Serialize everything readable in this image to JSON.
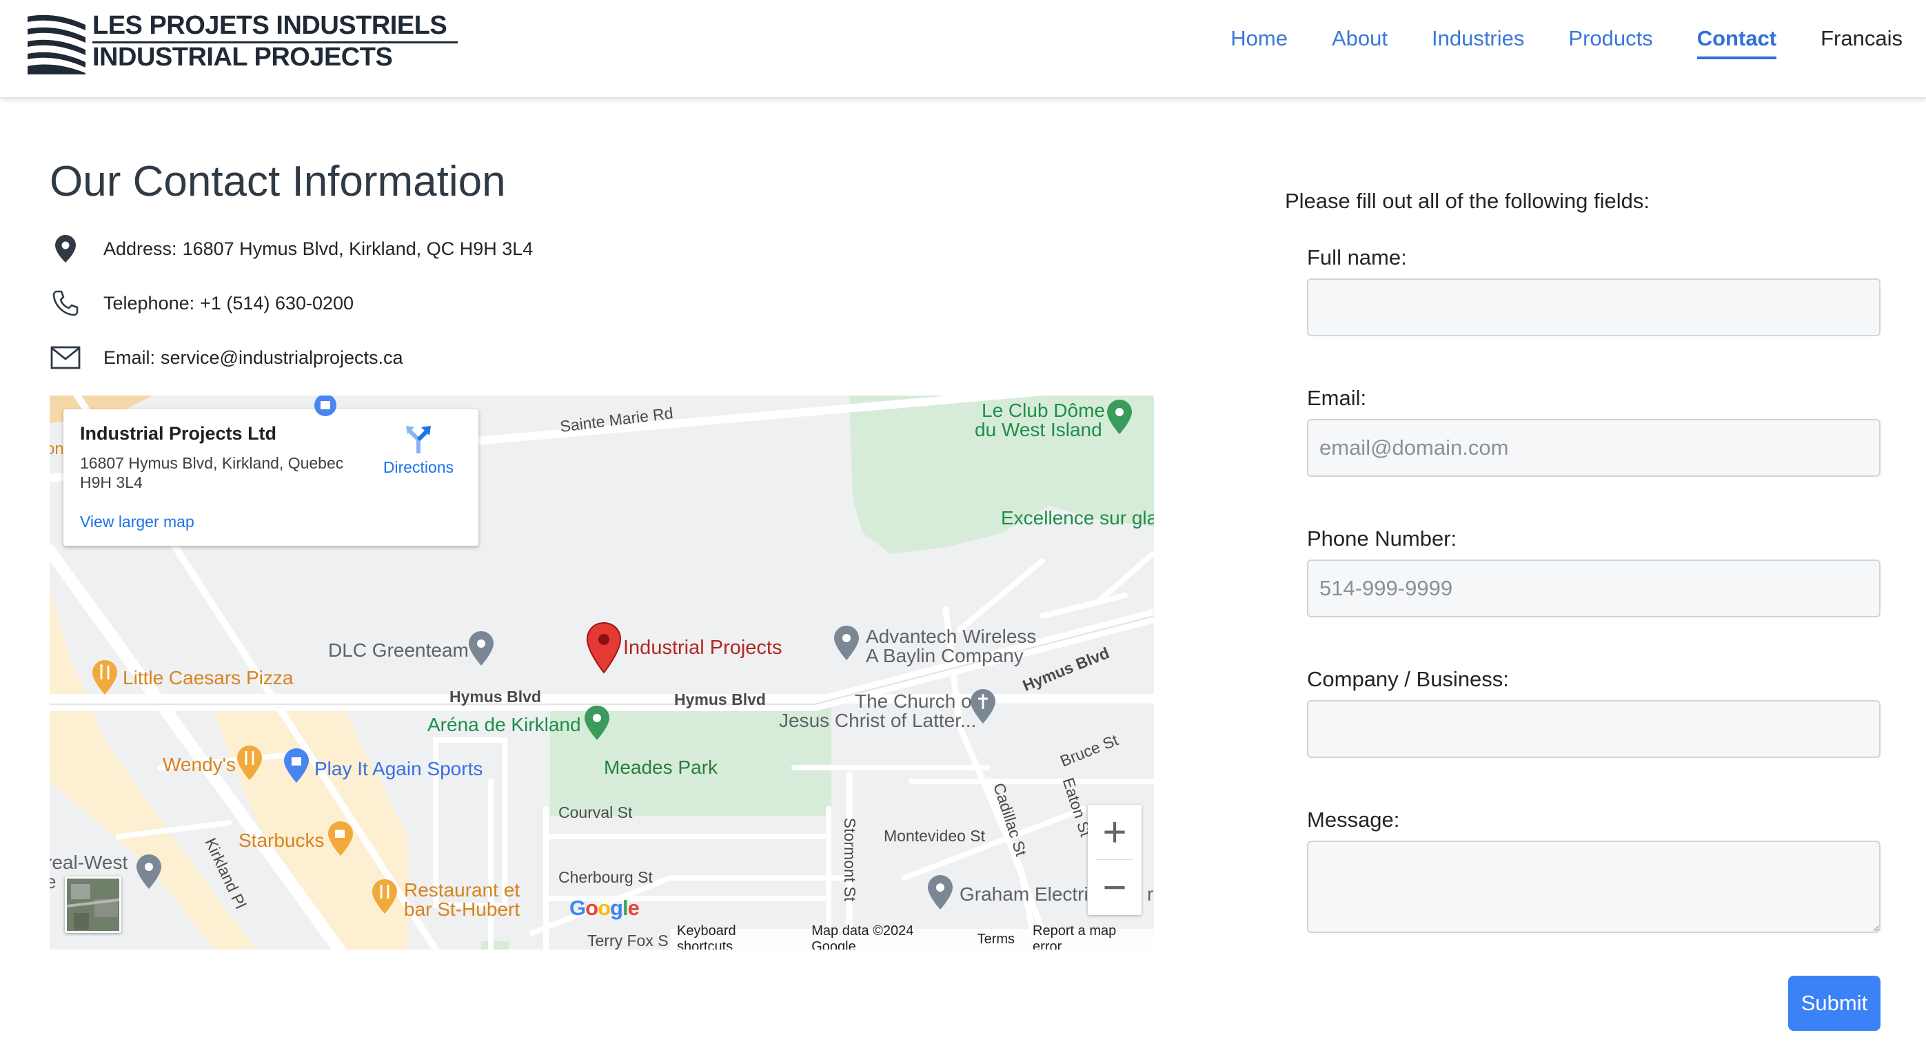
{
  "brand": {
    "line1": "LES PROJETS INDUSTRIELS",
    "line2": "INDUSTRIAL PROJECTS"
  },
  "nav": {
    "items": [
      {
        "label": "Home",
        "active": false
      },
      {
        "label": "About",
        "active": false
      },
      {
        "label": "Industries",
        "active": false
      },
      {
        "label": "Products",
        "active": false
      },
      {
        "label": "Contact",
        "active": true
      }
    ],
    "language": "Francais"
  },
  "contact": {
    "title": "Our Contact Information",
    "address": {
      "label": "Address:",
      "value": "16807 Hymus Blvd, Kirkland, QC H9H 3L4",
      "icon": "map-pin-icon"
    },
    "telephone": {
      "label": "Telephone:",
      "value": "+1 (514) 630-0200",
      "icon": "phone-icon"
    },
    "email": {
      "label": "Email:",
      "value": "service@industrialprojects.ca",
      "icon": "envelope-icon"
    }
  },
  "map": {
    "card": {
      "name": "Industrial Projects Ltd",
      "address": "16807 Hymus Blvd, Kirkland, Quebec H9H 3L4",
      "directions": "Directions",
      "larger_map": "View larger map"
    },
    "labels": {
      "sainte_marie": "Sainte Marie Rd",
      "club_dome_1": "Le Club Dôme",
      "club_dome_2": "du West Island",
      "excellence": "Excellence sur gla",
      "dlc": "DLC Greenteam",
      "industrial_projects": "Industrial Projects",
      "advantech_1": "Advantech Wireless",
      "advantech_2": "A Baylin Company",
      "little_caesars": "Little Caesars Pizza",
      "hymus_1": "Hymus Blvd",
      "hymus_2": "Hymus Blvd",
      "hymus_3": "Hymus Blvd",
      "church_1": "The Church of",
      "church_2": "Jesus Christ of Latter...",
      "arena": "Aréna de Kirkland",
      "bruce": "Bruce St",
      "wendys": "Wendy's",
      "play_it_again": "Play It Again Sports",
      "meades": "Meades Park",
      "eaton": "Eaton St",
      "cadillac": "Cadillac St",
      "courval": "Courval St",
      "starbucks": "Starbucks",
      "montevideo": "Montevideo St",
      "stormont": "Stormont St",
      "real_west_1": "real-West",
      "real_west_2": "e",
      "kirkland_pl": "Kirkland Pl",
      "restaurant_1": "Restaurant et",
      "restaurant_2": "bar St-Hubert",
      "cherbourg": "Cherbourg St",
      "graham": "Graham Electri",
      "graham_tail": "r",
      "terry_fox": "Terry Fox S",
      "top_partial": "on"
    },
    "google_logo": "Google",
    "zoom_in": "+",
    "zoom_out": "−",
    "attribution": {
      "shortcuts": "Keyboard shortcuts",
      "data": "Map data ©2024 Google",
      "terms": "Terms",
      "report": "Report a map error"
    }
  },
  "form": {
    "intro": "Please fill out all of the following fields:",
    "full_name": {
      "label": "Full name:",
      "placeholder": "",
      "value": ""
    },
    "email": {
      "label": "Email:",
      "placeholder": "email@domain.com",
      "value": ""
    },
    "phone": {
      "label": "Phone Number:",
      "placeholder": "514-999-9999",
      "value": ""
    },
    "company": {
      "label": "Company / Business:",
      "placeholder": "",
      "value": ""
    },
    "message": {
      "label": "Message:",
      "placeholder": "",
      "value": ""
    },
    "submit": "Submit"
  },
  "colors": {
    "accent": "#3b82f6",
    "nav_link": "#3a78d8",
    "heading": "#2f3a45"
  }
}
